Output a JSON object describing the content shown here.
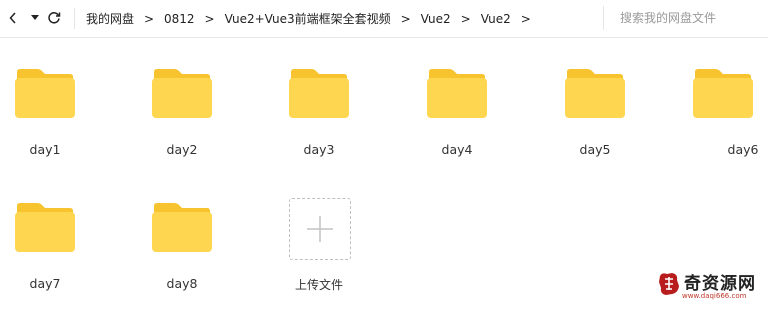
{
  "breadcrumb": {
    "items": [
      "我的网盘",
      "0812",
      "Vue2+Vue3前端框架全套视频",
      "Vue2",
      "Vue2"
    ],
    "separator": ">"
  },
  "search": {
    "placeholder": "搜索我的网盘文件"
  },
  "folders": [
    {
      "label": "day1"
    },
    {
      "label": "day2"
    },
    {
      "label": "day3"
    },
    {
      "label": "day4"
    },
    {
      "label": "day5"
    },
    {
      "label": "day6"
    },
    {
      "label": "day7"
    },
    {
      "label": "day8"
    }
  ],
  "upload": {
    "label": "上传文件"
  },
  "icons": {
    "folder": "folder-icon",
    "upload": "plus-icon",
    "refresh": "refresh-icon",
    "dropdown": "caret-down-icon",
    "left": "chevron-left-icon"
  },
  "colors": {
    "folder_body": "#FFD64F",
    "folder_tab": "#F7C32E"
  },
  "watermark": {
    "brand": "奇资源网",
    "url": "www.daqi666.com"
  }
}
